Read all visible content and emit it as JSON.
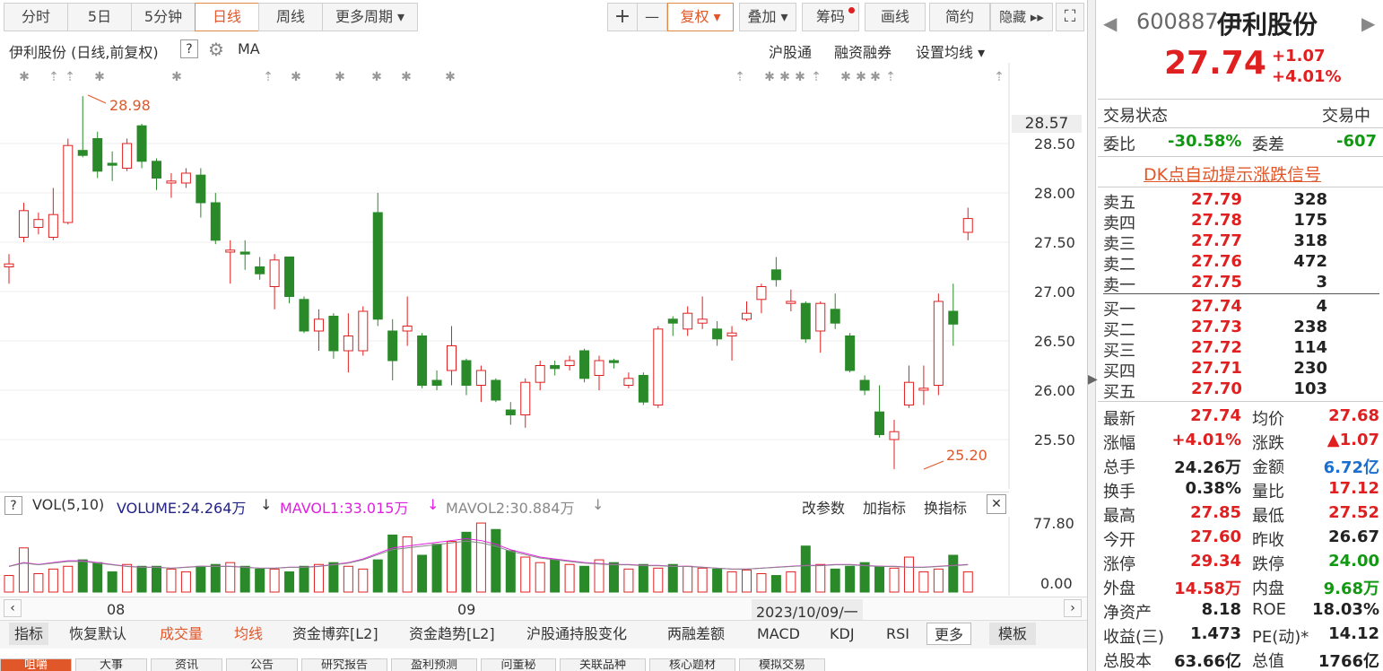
{
  "toolbar": {
    "periods": [
      "分时",
      "5日",
      "5分钟",
      "日线",
      "周线",
      "更多周期 ▾"
    ],
    "zoom_in": "+",
    "zoom_out": "—",
    "fuquan": "复权 ▾",
    "overlay": "叠加 ▾",
    "chips": "筹码",
    "draw": "画线",
    "simple": "简约",
    "hide": "隐藏 ▸▸"
  },
  "chart_header": {
    "title": "伊利股份 (日线,前复权)",
    "help": "?",
    "indicator": "MA",
    "links": [
      "沪股通",
      "融资融券",
      "设置均线 ▾"
    ]
  },
  "price_axis": {
    "labels": [
      "28.50",
      "28.00",
      "27.50",
      "27.00",
      "26.50",
      "26.00",
      "25.50"
    ],
    "current": "28.57"
  },
  "annotations": {
    "high": "28.98",
    "low": "25.20"
  },
  "volume_header": {
    "help": "?",
    "name": "VOL(5,10)",
    "volume": "VOLUME:24.264万",
    "mavol1": "MAVOL1:33.015万",
    "mavol2": "MAVOL2:30.884万",
    "links": [
      "改参数",
      "加指标",
      "换指标"
    ],
    "close": "✕"
  },
  "volume_axis": {
    "max": "77.80",
    "min": "0.00"
  },
  "time_axis": {
    "labels": [
      "08",
      "09"
    ],
    "cursor_date": "2023/10/09/一"
  },
  "indicator_bar": {
    "items": [
      "指标",
      "恢复默认",
      "成交量",
      "均线",
      "资金博弈[L2]",
      "资金趋势[L2]",
      "沪股通持股变化",
      "两融差额",
      "MACD",
      "KDJ",
      "RSI",
      "更多",
      "模板"
    ]
  },
  "bottom_tabs": [
    "咀嚼",
    "大事",
    "资讯",
    "公告",
    "研究报告",
    "盈利预测",
    "问董秘",
    "关联品种",
    "核心题材",
    "模拟交易"
  ],
  "quote": {
    "code": "600887",
    "name": "伊利股份",
    "price": "27.74",
    "change": "+1.07",
    "change_pct": "+4.01%"
  },
  "status": {
    "label": "交易状态",
    "value": "交易中",
    "weibi_label": "委比",
    "weibi": "-30.58%",
    "weicha_label": "委差",
    "weicha": "-607",
    "dk": "DK点自动提示涨跌信号"
  },
  "orderbook": {
    "asks": [
      {
        "label": "卖五",
        "price": "27.79",
        "vol": "328"
      },
      {
        "label": "卖四",
        "price": "27.78",
        "vol": "175"
      },
      {
        "label": "卖三",
        "price": "27.77",
        "vol": "318"
      },
      {
        "label": "卖二",
        "price": "27.76",
        "vol": "472"
      },
      {
        "label": "卖一",
        "price": "27.75",
        "vol": "3"
      }
    ],
    "bids": [
      {
        "label": "买一",
        "price": "27.74",
        "vol": "4"
      },
      {
        "label": "买二",
        "price": "27.73",
        "vol": "238"
      },
      {
        "label": "买三",
        "price": "27.72",
        "vol": "114"
      },
      {
        "label": "买四",
        "price": "27.71",
        "vol": "230"
      },
      {
        "label": "买五",
        "price": "27.70",
        "vol": "103"
      }
    ]
  },
  "stats": [
    {
      "l1": "最新",
      "v1": "27.74",
      "l2": "均价",
      "v2": "27.68"
    },
    {
      "l1": "涨幅",
      "v1": "+4.01%",
      "l2": "涨跌",
      "v2": "▲1.07"
    },
    {
      "l1": "总手",
      "v1": "24.26万",
      "l2": "金额",
      "v2": "6.72亿"
    },
    {
      "l1": "换手",
      "v1": "0.38%",
      "l2": "量比",
      "v2": "17.12"
    },
    {
      "l1": "最高",
      "v1": "27.85",
      "l2": "最低",
      "v2": "27.52"
    },
    {
      "l1": "今开",
      "v1": "27.60",
      "l2": "昨收",
      "v2": "26.67"
    },
    {
      "l1": "涨停",
      "v1": "29.34",
      "l2": "跌停",
      "v2": "24.00"
    },
    {
      "l1": "外盘",
      "v1": "14.58万",
      "l2": "内盘",
      "v2": "9.68万"
    },
    {
      "l1": "净资产",
      "v1": "8.18",
      "l2": "ROE",
      "v2": "18.03%"
    },
    {
      "l1": "收益(三)",
      "v1": "1.473",
      "l2": "PE(动)*",
      "v2": "14.12"
    },
    {
      "l1": "总股本",
      "v1": "63.66亿",
      "l2": "总值",
      "v2": "1766亿"
    }
  ],
  "colors": {
    "up": "#e02020",
    "down": "#2a8a2a",
    "accent": "#e0572a",
    "ma1": "#e020e0",
    "ma2": "#888888"
  },
  "chart_data": {
    "type": "candlestick",
    "yrange": [
      25.0,
      29.2
    ],
    "candles": [
      [
        27.25,
        27.28,
        27.38,
        27.08
      ],
      [
        27.55,
        27.82,
        27.9,
        27.5
      ],
      [
        27.65,
        27.73,
        27.8,
        27.58
      ],
      [
        27.55,
        27.78,
        28.05,
        27.52
      ],
      [
        27.7,
        28.48,
        28.55,
        27.68
      ],
      [
        28.43,
        28.38,
        28.98,
        28.36
      ],
      [
        28.55,
        28.22,
        28.62,
        28.15
      ],
      [
        28.3,
        28.28,
        28.42,
        28.12
      ],
      [
        28.25,
        28.5,
        28.55,
        28.22
      ],
      [
        28.68,
        28.32,
        28.7,
        28.25
      ],
      [
        28.32,
        28.15,
        28.35,
        28.03
      ],
      [
        28.1,
        28.12,
        28.2,
        27.95
      ],
      [
        28.1,
        28.2,
        28.25,
        28.05
      ],
      [
        28.18,
        27.9,
        28.25,
        27.75
      ],
      [
        27.9,
        27.52,
        28.0,
        27.48
      ],
      [
        27.4,
        27.42,
        27.52,
        27.08
      ],
      [
        27.4,
        27.38,
        27.52,
        27.22
      ],
      [
        27.25,
        27.18,
        27.35,
        27.12
      ],
      [
        27.05,
        27.32,
        27.38,
        26.82
      ],
      [
        27.35,
        26.95,
        27.35,
        26.88
      ],
      [
        26.92,
        26.6,
        26.95,
        26.58
      ],
      [
        26.6,
        26.72,
        26.82,
        26.4
      ],
      [
        26.75,
        26.4,
        26.78,
        26.32
      ],
      [
        26.4,
        26.55,
        26.78,
        26.18
      ],
      [
        26.4,
        26.8,
        26.85,
        26.35
      ],
      [
        27.8,
        26.72,
        28.0,
        26.65
      ],
      [
        26.6,
        26.3,
        26.72,
        26.1
      ],
      [
        26.6,
        26.65,
        26.95,
        26.45
      ],
      [
        26.55,
        26.05,
        26.58,
        26.02
      ],
      [
        26.1,
        26.05,
        26.2,
        26.0
      ],
      [
        26.2,
        26.45,
        26.65,
        26.05
      ],
      [
        26.3,
        26.05,
        26.32,
        25.95
      ],
      [
        26.05,
        26.2,
        26.25,
        25.88
      ],
      [
        26.1,
        25.9,
        26.12,
        25.88
      ],
      [
        25.8,
        25.75,
        25.88,
        25.65
      ],
      [
        25.75,
        26.08,
        26.12,
        25.62
      ],
      [
        26.08,
        26.25,
        26.3,
        26.0
      ],
      [
        26.25,
        26.22,
        26.3,
        26.15
      ],
      [
        26.25,
        26.3,
        26.35,
        26.2
      ],
      [
        26.4,
        26.12,
        26.42,
        26.08
      ],
      [
        26.15,
        26.3,
        26.35,
        26.0
      ],
      [
        26.3,
        26.28,
        26.32,
        26.22
      ],
      [
        26.05,
        26.12,
        26.18,
        26.02
      ],
      [
        26.15,
        25.88,
        26.18,
        25.85
      ],
      [
        25.85,
        26.62,
        26.65,
        25.82
      ],
      [
        26.72,
        26.68,
        26.75,
        26.55
      ],
      [
        26.62,
        26.78,
        26.85,
        26.55
      ],
      [
        26.68,
        26.72,
        26.95,
        26.62
      ],
      [
        26.62,
        26.52,
        26.7,
        26.45
      ],
      [
        26.55,
        26.58,
        26.65,
        26.3
      ],
      [
        26.72,
        26.78,
        26.9,
        26.7
      ],
      [
        26.92,
        27.05,
        27.08,
        26.78
      ],
      [
        27.22,
        27.12,
        27.35,
        27.05
      ],
      [
        26.88,
        26.9,
        27.02,
        26.8
      ],
      [
        26.88,
        26.52,
        26.9,
        26.48
      ],
      [
        26.6,
        26.88,
        26.9,
        26.38
      ],
      [
        26.82,
        26.68,
        26.98,
        26.62
      ],
      [
        26.55,
        26.2,
        26.58,
        26.18
      ],
      [
        26.1,
        26.0,
        26.15,
        25.95
      ],
      [
        25.78,
        25.55,
        26.05,
        25.52
      ],
      [
        25.5,
        25.58,
        25.7,
        25.2
      ],
      [
        25.85,
        26.08,
        26.25,
        25.82
      ],
      [
        26.0,
        26.02,
        26.25,
        25.85
      ],
      [
        26.05,
        26.9,
        26.98,
        25.95
      ],
      [
        26.8,
        26.67,
        27.08,
        26.45
      ],
      [
        27.6,
        27.74,
        27.85,
        27.52
      ]
    ],
    "volume_max": 77.8,
    "volumes": [
      18,
      48,
      20,
      25,
      28,
      35,
      32,
      22,
      30,
      28,
      28,
      25,
      22,
      28,
      30,
      32,
      28,
      25,
      25,
      22,
      28,
      30,
      32,
      28,
      25,
      35,
      62,
      60,
      40,
      52,
      55,
      65,
      75,
      68,
      45,
      38,
      32,
      35,
      30,
      28,
      35,
      32,
      25,
      30,
      26,
      30,
      28,
      26,
      25,
      22,
      24,
      20,
      18,
      22,
      50,
      30,
      25,
      28,
      32,
      28,
      26,
      38,
      22,
      25,
      40,
      22
    ],
    "mavol1": [
      28,
      32,
      30,
      32,
      34,
      34,
      32,
      30,
      28,
      27,
      27,
      26,
      27,
      28,
      28,
      28,
      27,
      26,
      26,
      27,
      27,
      28,
      30,
      32,
      36,
      42,
      48,
      50,
      52,
      54,
      56,
      58,
      56,
      52,
      46,
      42,
      38,
      36,
      34,
      32,
      31,
      30,
      30,
      29,
      29,
      28,
      28,
      27,
      26,
      25,
      25,
      26,
      27,
      28,
      29,
      29,
      30,
      30,
      29,
      28,
      28,
      27,
      27,
      28,
      29,
      30
    ]
  }
}
